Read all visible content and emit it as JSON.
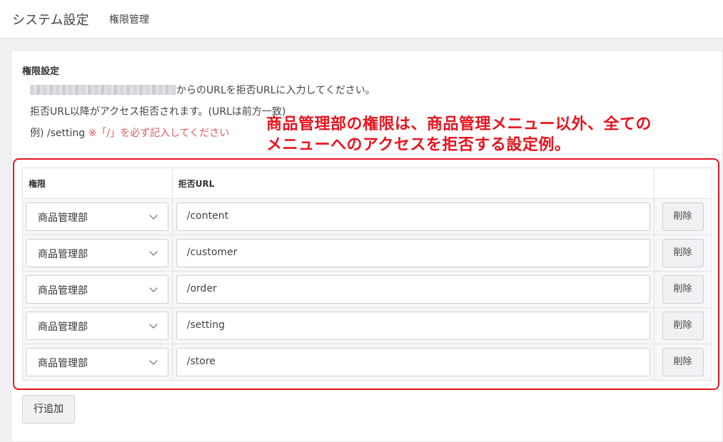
{
  "header": {
    "title": "システム設定",
    "subtitle": "権限管理"
  },
  "section": {
    "title": "権限設定",
    "desc_line1": "からのURLを拒否URLに入力してください。",
    "desc_line2": "拒否URL以降がアクセス拒否されます。(URLは前方一致)",
    "example_prefix": "例) /setting ",
    "example_note": "※「/」を必ず記入してください"
  },
  "annotation": {
    "line1": "商品管理部の権限は、商品管理メニュー以外、全ての",
    "line2": "メニューへのアクセスを拒否する設定例。"
  },
  "table": {
    "headers": {
      "role": "権限",
      "url": "拒否URL",
      "action": ""
    },
    "rows": [
      {
        "role": "商品管理部",
        "url": "/content",
        "delete_label": "削除"
      },
      {
        "role": "商品管理部",
        "url": "/customer",
        "delete_label": "削除"
      },
      {
        "role": "商品管理部",
        "url": "/order",
        "delete_label": "削除"
      },
      {
        "role": "商品管理部",
        "url": "/setting",
        "delete_label": "削除"
      },
      {
        "role": "商品管理部",
        "url": "/store",
        "delete_label": "削除"
      }
    ]
  },
  "add_row_label": "行追加",
  "icons": {
    "select_arrow": "chevron-down-icon"
  },
  "colors": {
    "annotation_red": "#e8141e",
    "note_red": "#e05a5a"
  }
}
